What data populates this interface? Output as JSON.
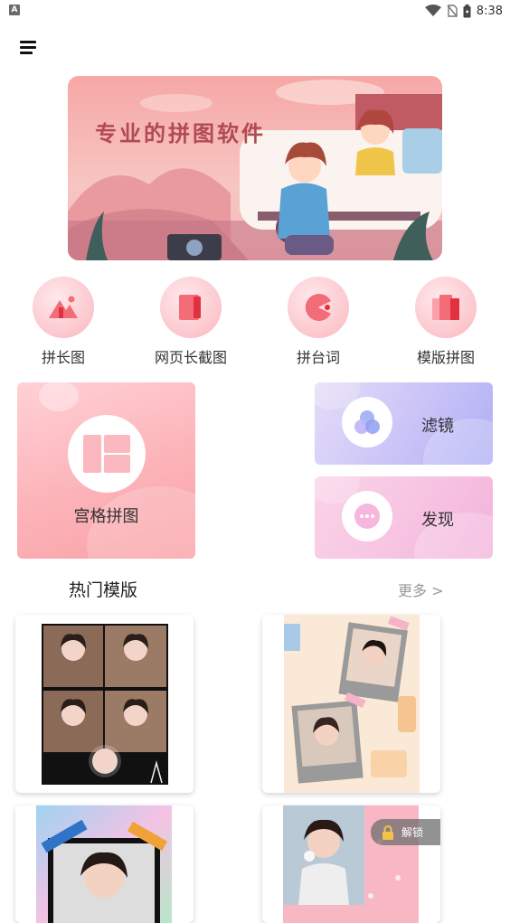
{
  "status_bar": {
    "time": "8:38"
  },
  "banner": {
    "title": "专业的拼图软件"
  },
  "quick_actions": [
    {
      "label": "拼长图",
      "icon": "mountain-icon"
    },
    {
      "label": "网页长截图",
      "icon": "page-icon"
    },
    {
      "label": "拼台词",
      "icon": "pacman-icon"
    },
    {
      "label": "模版拼图",
      "icon": "template-icon"
    }
  ],
  "features": {
    "grid_collage": "宫格拼图",
    "filter": "滤镜",
    "discover": "发现"
  },
  "hot_templates": {
    "title": "热门模版",
    "more": "更多 >",
    "lock_label": "解锁"
  },
  "colors": {
    "accent_pink": "#f9b4bb",
    "filter_purple": "#b7b8f5",
    "discover_pink": "#f6bfe0"
  }
}
